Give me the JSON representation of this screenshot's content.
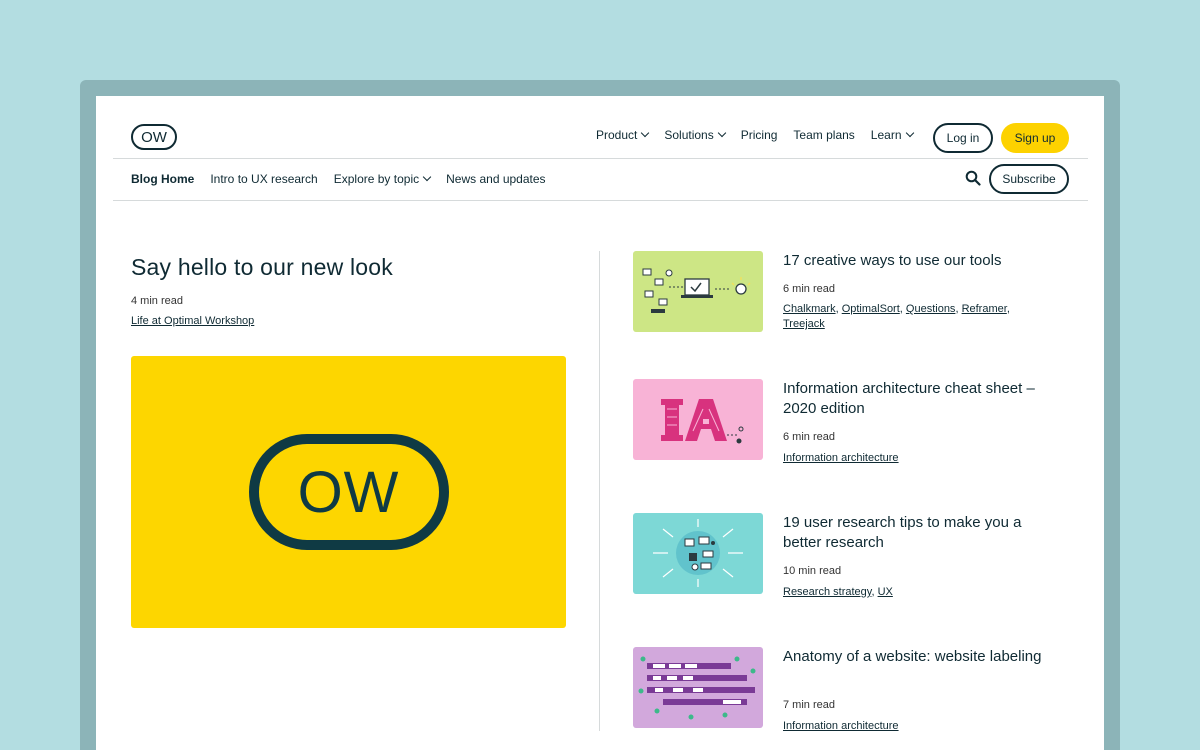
{
  "brand": {
    "logo_text": "OW"
  },
  "main_nav": [
    {
      "label": "Product",
      "dropdown": true
    },
    {
      "label": "Solutions",
      "dropdown": true
    },
    {
      "label": "Pricing",
      "dropdown": false
    },
    {
      "label": "Team plans",
      "dropdown": false
    },
    {
      "label": "Learn",
      "dropdown": true
    }
  ],
  "auth": {
    "login_label": "Log in",
    "signup_label": "Sign up"
  },
  "sub_nav": [
    {
      "label": "Blog Home",
      "active": true,
      "dropdown": false
    },
    {
      "label": "Intro to UX research",
      "active": false,
      "dropdown": false
    },
    {
      "label": "Explore by topic",
      "active": false,
      "dropdown": true
    },
    {
      "label": "News and updates",
      "active": false,
      "dropdown": false
    }
  ],
  "subscribe_label": "Subscribe",
  "featured": {
    "title": "Say hello to our new look",
    "read_time": "4 min read",
    "tag": "Life at Optimal Workshop",
    "image_logo_text": "OW"
  },
  "articles": [
    {
      "title": "17 creative ways to use our tools",
      "read_time": "6 min read",
      "tags": [
        "Chalkmark",
        "OptimalSort",
        "Questions",
        "Reframer",
        "Treejack"
      ],
      "thumb_color": "#cde685"
    },
    {
      "title": "Information architecture cheat sheet – 2020 edition",
      "read_time": "6 min read",
      "tags": [
        "Information architecture"
      ],
      "thumb_color": "#f8b3d6"
    },
    {
      "title": "19 user research tips to make you a better research",
      "read_time": "10 min read",
      "tags": [
        "Research strategy",
        "UX"
      ],
      "thumb_color": "#7dd8d6"
    },
    {
      "title": "Anatomy of a website: website labeling",
      "read_time": "7 min read",
      "tags": [
        "Information architecture"
      ],
      "thumb_color": "#d2a8dc"
    }
  ],
  "colors": {
    "background": "#b3dde1",
    "frame": "#8cb4b8",
    "accent_yellow": "#fdd200",
    "ink": "#0f2a33"
  }
}
